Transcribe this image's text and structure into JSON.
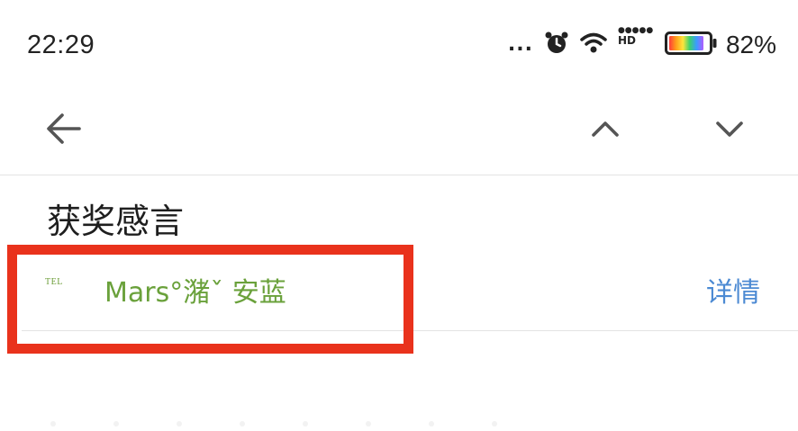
{
  "status_bar": {
    "time": "22:29",
    "signal_dots": "...",
    "hd_label": "HD",
    "battery_percent": "82%",
    "battery_level": 0.82
  },
  "toolbar": {
    "back_icon": "arrow-left-icon",
    "prev_icon": "chevron-up-icon",
    "next_icon": "chevron-down-icon"
  },
  "message": {
    "subject": "获奖感言",
    "tel_badge": "TEL",
    "sender": "Mars°潴ˇ 安蓝",
    "details_label": "详情"
  },
  "colors": {
    "sender": "#6aa13b",
    "details_link": "#4c8ad3",
    "highlight": "#e9321c",
    "divider": "#e3e3e3"
  }
}
